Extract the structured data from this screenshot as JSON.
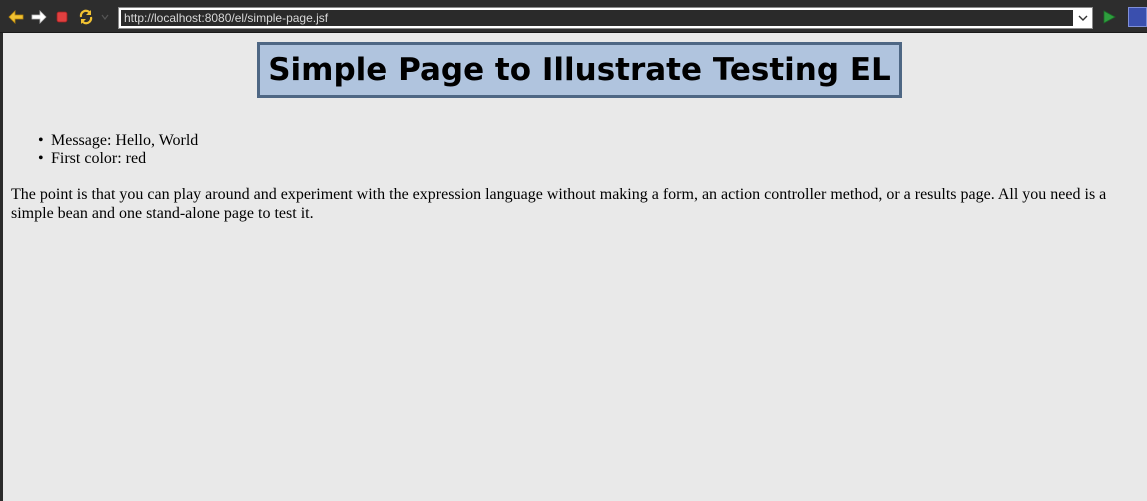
{
  "toolbar": {
    "back_icon": "back-arrow-icon",
    "forward_icon": "forward-arrow-icon",
    "stop_icon": "stop-icon",
    "refresh_icon": "refresh-icon",
    "url": "http://localhost:8080/el/simple-page.jsf",
    "go_icon": "go-icon"
  },
  "page": {
    "title": "Simple Page to Illustrate Testing EL",
    "items": [
      "Message: Hello, World",
      "First color: red"
    ],
    "paragraph": "The point is that you can play around and experiment with the expression language without making a form, an action controller method, or a results page. All you need is a simple bean and one stand-alone page to test it."
  },
  "colors": {
    "title_bg": "#b0c4de",
    "title_border": "#4e6784",
    "page_bg": "#e9e9e9",
    "toolbar_bg": "#2d2d2d"
  }
}
